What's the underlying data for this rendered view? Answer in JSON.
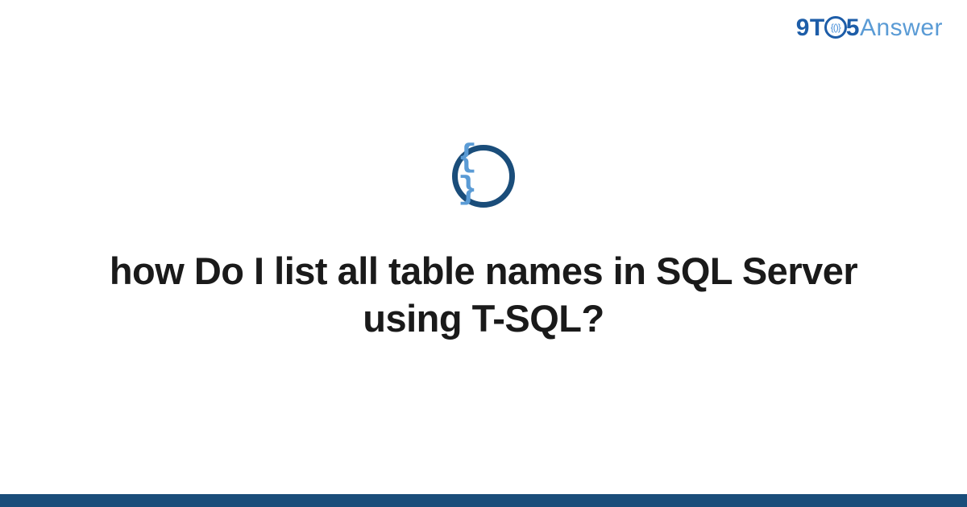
{
  "logo": {
    "part1": "9T",
    "circle_inner": "{()}",
    "part2": "5",
    "part3": "Answer"
  },
  "icon": {
    "name": "code-braces-icon",
    "glyph": "{ }"
  },
  "title": "how Do I list all table names in SQL Server using T-SQL?",
  "colors": {
    "brand_dark": "#1a4d7a",
    "brand_blue": "#1d5da8",
    "brand_light": "#5a9bd5"
  }
}
